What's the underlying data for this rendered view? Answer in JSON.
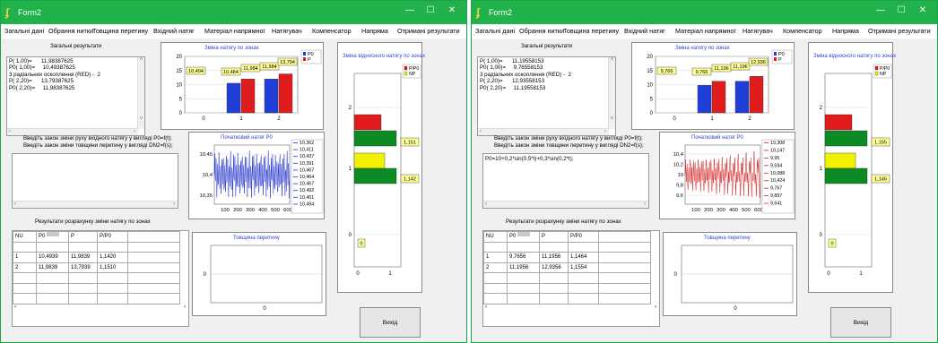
{
  "windows": [
    {
      "title": "Form2",
      "menu": [
        "Загальні дані",
        "Обрання нитки",
        "Товщина перетину",
        "Вхідний натяг",
        "Матеріал напрямної",
        "Натягувач",
        "Компенсатор",
        "Напряма",
        "Отримані результати"
      ],
      "results_label": "Загальні результати",
      "results_lines": [
        "P( 1,00)=      11,98387625",
        "P0( 1,00)=     10,49387625",
        "3 радіальних оскоплення (RED) -  2",
        "P( 2,20)=      13,79387625",
        "P0( 2,20)=     11,98387625"
      ],
      "law_lines": [
        "Введіть закон зміни руху вхідного натягу у вигляді P0=f(t);",
        "Введіть закон зміни товщини перетину у вигляді DN2=f(s);"
      ],
      "law_input": "",
      "table_label": "Результати розрахунку зміни натягу по зонах",
      "table": {
        "headers": [
          "NU",
          "P0",
          "P",
          "P/P0"
        ],
        "rows": [
          [
            "1",
            "10,4939",
            "11,9839",
            "1,1420"
          ],
          [
            "2",
            "11,9839",
            "13,7939",
            "1,1510"
          ]
        ]
      },
      "zone_chart": {
        "title": "Зміна натягу по зонах",
        "legend": [
          "P0",
          "P"
        ],
        "y_ticks": [
          "20",
          "15",
          "10",
          "5",
          "0"
        ],
        "x_ticks": [
          "0",
          "1",
          "2"
        ],
        "labels": [
          "10,494",
          "10,484",
          "11,984",
          "11,984",
          "13,794"
        ]
      },
      "init_chart": {
        "title": "Початковий натяг P0",
        "y_ticks": [
          "10,45",
          "10,4",
          "10,35"
        ],
        "x_ticks": [
          "100",
          "200",
          "300",
          "400",
          "500",
          "600"
        ],
        "legend": [
          "10,362",
          "10,411",
          "10,437",
          "10,391",
          "10,467",
          "10,464",
          "10,467",
          "10,492",
          "10,451",
          "10,494"
        ]
      },
      "thickness_chart": {
        "title": "Товщина перетину",
        "y_tick": "0",
        "x_tick": "0"
      },
      "relative_chart": {
        "title": "Зміна відносного натягу по зонах",
        "legend": [
          "P/P0",
          "NP"
        ],
        "labels": [
          "1,151",
          "1,142",
          "0"
        ],
        "y_ticks": [
          "2",
          "1",
          "0"
        ],
        "x_ticks": [
          "0",
          "1"
        ]
      },
      "exit_label": "Вихід"
    },
    {
      "title": "Form2",
      "menu": [
        "Загальні дані",
        "Обрання нитки",
        "Товщина перетину",
        "Вхідний натяг",
        "Матеріал напрямної",
        "Натягувач",
        "Компенсатор",
        "Напряма",
        "Отримані результати"
      ],
      "results_label": "Загальні результати",
      "results_lines": [
        "P( 1,00)=      11,19558153",
        "P0( 1,00)=     9,76558153",
        "3 радіальних оскоплення (RED) -  2",
        "P( 2,20)=      12,93558153",
        "P0( 2,20)=     11,19558153"
      ],
      "law_lines": [
        "Введіть закон зміни руху вхідного натягу у вигляді P0=f(t);",
        "Введіть закон зміни товщини перетину у вигляді DN2=f(s);"
      ],
      "law_input": "P0=10+0,2*sin(0,5*t)+0,3*sin(0,2*t);",
      "table_label": "Результати розрахунку зміни натягу по зонах",
      "table": {
        "headers": [
          "NU",
          "P0",
          "P",
          "P/P0"
        ],
        "rows": [
          [
            "1",
            "9,7656",
            "11,1956",
            "1,1464"
          ],
          [
            "2",
            "11,1956",
            "12,9356",
            "1,1554"
          ]
        ]
      },
      "zone_chart": {
        "title": "Зміна натягу по зонах",
        "legend": [
          "P0",
          "P"
        ],
        "y_ticks": [
          "20",
          "15",
          "10",
          "5",
          "0"
        ],
        "x_ticks": [
          "0",
          "1",
          "2"
        ],
        "labels": [
          "9,766",
          "9,766",
          "11,196",
          "11,196",
          "12,936"
        ]
      },
      "init_chart": {
        "title": "Початковий натяг P0",
        "y_ticks": [
          "10,4",
          "10,2",
          "10",
          "9,8",
          "9,6"
        ],
        "x_ticks": [
          "100",
          "200",
          "300",
          "400",
          "500",
          "600"
        ],
        "legend": [
          "10,308",
          "10,147",
          "9,95",
          "9,594",
          "10,088",
          "10,424",
          "9,767",
          "9,897",
          "9,641"
        ]
      },
      "thickness_chart": {
        "title": "Товщина перетину",
        "y_tick": "0",
        "x_tick": "0"
      },
      "relative_chart": {
        "title": "Зміна відносного натягу по зонах",
        "legend": [
          "P/P0",
          "NP"
        ],
        "labels": [
          "1,155",
          "1,146",
          "0"
        ],
        "y_ticks": [
          "2",
          "1",
          "0"
        ],
        "x_ticks": [
          "0",
          "1"
        ]
      },
      "exit_label": "Вихід"
    }
  ],
  "colors": {
    "titlebar": "#21b24c",
    "p0": "#1f3fd8",
    "p": "#e01b1b",
    "green": "#0c8a23",
    "yellow": "#f2f200",
    "label_bg": "#ffff99",
    "series": "#2233cc",
    "series2": "#d42020"
  }
}
